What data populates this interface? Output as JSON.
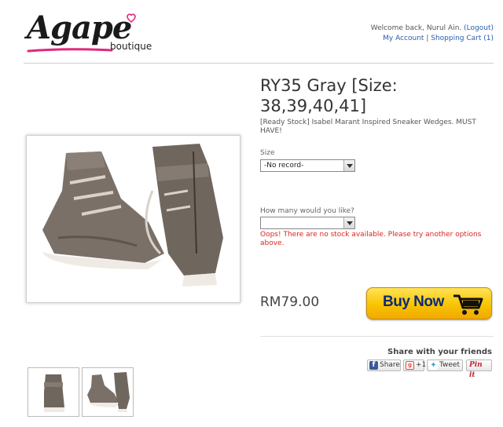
{
  "brand": {
    "name": "Agape",
    "sub": "boutique",
    "accent": "#e0297a"
  },
  "account": {
    "welcome": "Welcome back, Nurul Ain.",
    "logout": "(Logout)",
    "my_account": "My Account",
    "separator": "|",
    "cart": "Shopping Cart (1)"
  },
  "product": {
    "title": "RY35 Gray [Size: 38,39,40,41]",
    "description": "[Ready Stock] Isabel Marant Inspired Sneaker Wedges. MUST HAVE!",
    "size_label": "Size",
    "size_value": "-No record-",
    "qty_label": "How many would you like?",
    "qty_value": "",
    "error": "Oops! There are no stock available. Please try another options above.",
    "price": "RM79.00",
    "buy_label": "Buy Now"
  },
  "share": {
    "title": "Share with your friends",
    "facebook": "Share",
    "gplus": "+1",
    "twitter": "Tweet",
    "pinterest": "Pin it"
  },
  "colors": {
    "link": "#2a5db0",
    "error": "#d8261f",
    "button": "#f9c400"
  }
}
